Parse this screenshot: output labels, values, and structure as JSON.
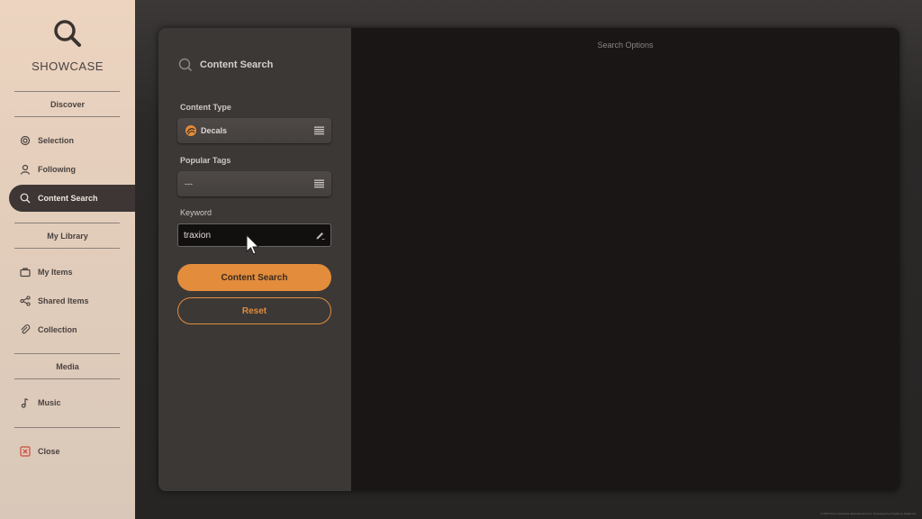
{
  "app": {
    "title": "SHOWCASE",
    "footer": "© 20XX Sony Interactive Entertainment Inc. Developed by Polyphony Digital Inc."
  },
  "sidebar": {
    "sections": [
      {
        "label": "Discover"
      },
      {
        "label": "My Library"
      },
      {
        "label": "Media"
      }
    ],
    "items": [
      {
        "label": "Selection",
        "icon": "gear-icon"
      },
      {
        "label": "Following",
        "icon": "person-icon"
      },
      {
        "label": "Content Search",
        "icon": "search-icon",
        "active": true
      },
      {
        "label": "My Items",
        "icon": "briefcase-icon"
      },
      {
        "label": "Shared Items",
        "icon": "share-icon"
      },
      {
        "label": "Collection",
        "icon": "paperclip-icon"
      },
      {
        "label": "Music",
        "icon": "music-note-icon"
      },
      {
        "label": "Close",
        "icon": "close-icon"
      }
    ]
  },
  "search_panel": {
    "title": "Content Search",
    "content_type": {
      "label": "Content Type",
      "value": "Decals",
      "icon": "decals-icon"
    },
    "popular_tags": {
      "label": "Popular Tags",
      "value": "---"
    },
    "keyword": {
      "label": "Keyword",
      "value": "traxion"
    },
    "search_button": "Content Search",
    "reset_button": "Reset"
  },
  "search_options": {
    "title": "Search Options"
  },
  "colors": {
    "accent": "#e28c3c",
    "sidebar_bg": "#e6d0be",
    "panel_bg": "#3c3836",
    "close_red": "#d04a3c"
  }
}
